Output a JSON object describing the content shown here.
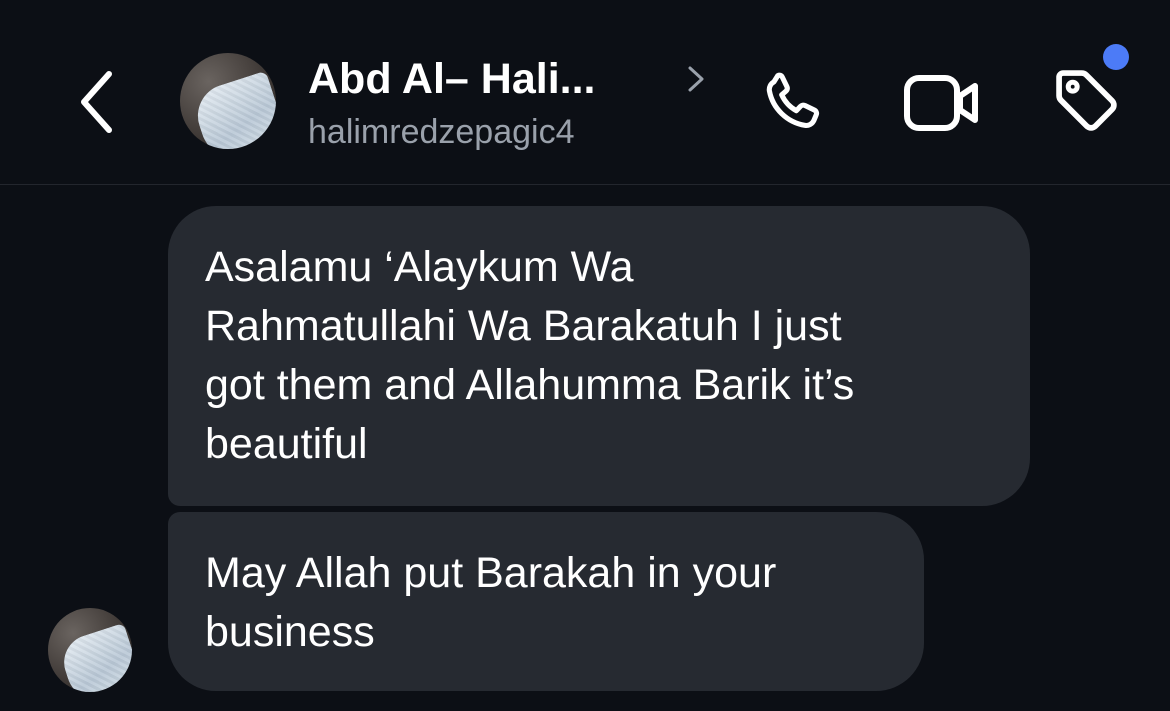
{
  "header": {
    "contact_name": "Abd Al– Hali...",
    "contact_handle": "halimredzepagic4",
    "icons": {
      "back": "chevron-left-icon",
      "name_disclosure": "chevron-right-icon",
      "call": "phone-icon",
      "video": "video-camera-icon",
      "tag": "tag-icon"
    },
    "notification_dot_color": "#4c7bf7"
  },
  "messages": [
    {
      "text": "Asalamu ‘Alaykum Wa\nRahmatullahi Wa Barakatuh I just\ngot them and Allahumma Barik it’s\nbeautiful"
    },
    {
      "text": "May Allah put Barakah in your\nbusiness"
    }
  ],
  "colors": {
    "background": "#0c0f15",
    "bubble": "#262a31",
    "handle_text": "#9aa1ab",
    "accent": "#4c7bf7"
  }
}
